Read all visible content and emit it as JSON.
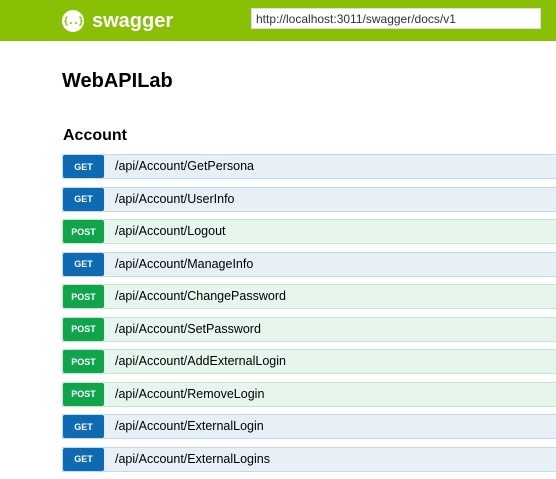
{
  "topbar": {
    "logo_icon_text": "{..}",
    "logo_text": "swagger",
    "url_value": "http://localhost:3011/swagger/docs/v1",
    "accent_color": "#89bf04"
  },
  "api": {
    "title": "WebAPILab"
  },
  "section": {
    "title": "Account"
  },
  "operations": [
    {
      "method": "GET",
      "path": "/api/Account/GetPersona"
    },
    {
      "method": "GET",
      "path": "/api/Account/UserInfo"
    },
    {
      "method": "POST",
      "path": "/api/Account/Logout"
    },
    {
      "method": "GET",
      "path": "/api/Account/ManageInfo"
    },
    {
      "method": "POST",
      "path": "/api/Account/ChangePassword"
    },
    {
      "method": "POST",
      "path": "/api/Account/SetPassword"
    },
    {
      "method": "POST",
      "path": "/api/Account/AddExternalLogin"
    },
    {
      "method": "POST",
      "path": "/api/Account/RemoveLogin"
    },
    {
      "method": "GET",
      "path": "/api/Account/ExternalLogin"
    },
    {
      "method": "GET",
      "path": "/api/Account/ExternalLogins"
    }
  ],
  "colors": {
    "get": "#0f6ab4",
    "post": "#10a54a"
  }
}
